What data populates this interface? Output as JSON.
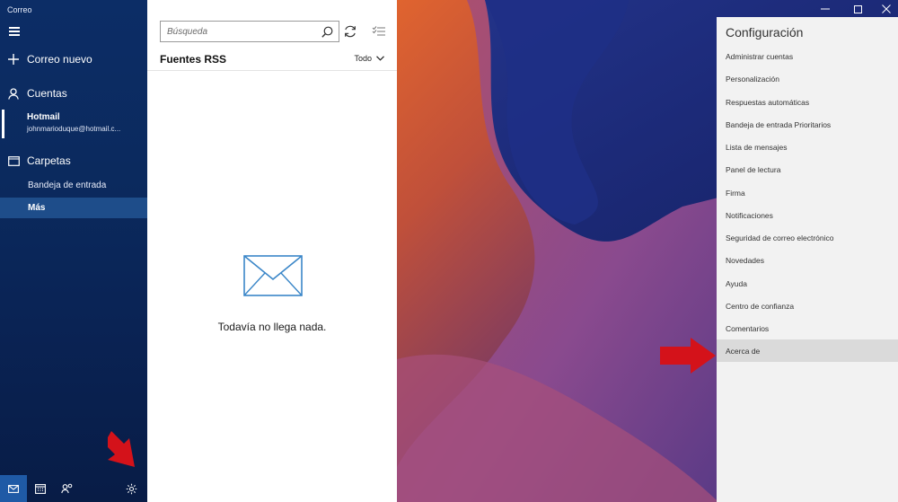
{
  "window": {
    "title": "Correo"
  },
  "nav": {
    "new_mail": "Correo nuevo",
    "accounts_header": "Cuentas",
    "account": {
      "name": "Hotmail",
      "email": "johnmarioduque@hotmail.c..."
    },
    "folders_header": "Carpetas",
    "folders": [
      {
        "label": "Bandeja de entrada",
        "selected": false
      },
      {
        "label": "Más",
        "selected": true
      }
    ],
    "bottom_icons": [
      "mail-icon",
      "calendar-icon",
      "people-icon",
      "gear-icon"
    ]
  },
  "list": {
    "search": {
      "placeholder": "Búsqueda"
    },
    "folder_title": "Fuentes RSS",
    "filter": "Todo",
    "empty_message": "Todavía no llega nada."
  },
  "settings": {
    "title": "Configuración",
    "items": [
      "Administrar cuentas",
      "Personalización",
      "Respuestas automáticas",
      "Bandeja de entrada Prioritarios",
      "Lista de mensajes",
      "Panel de lectura",
      "Firma",
      "Notificaciones",
      "Seguridad de correo electrónico",
      "Novedades",
      "Ayuda",
      "Centro de confianza",
      "Comentarios",
      "Acerca de"
    ],
    "highlighted_item": "Acerca de"
  },
  "colors": {
    "nav_bg": "#0b2a5e",
    "nav_selected": "#1e4d8a",
    "accent": "#1f5aa6",
    "annotation_red": "#d4121a"
  }
}
